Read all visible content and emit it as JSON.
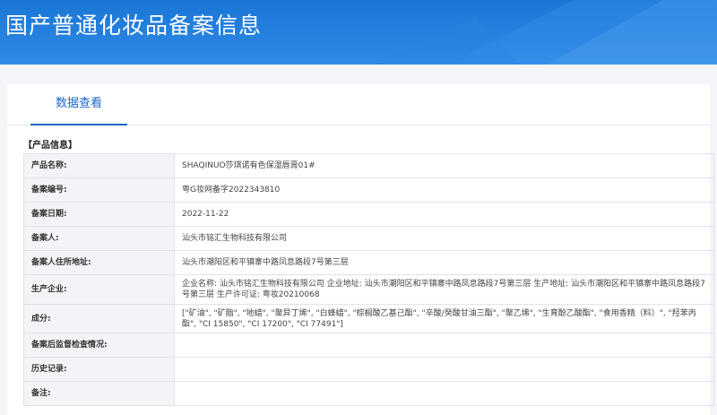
{
  "header": {
    "title": "国产普通化妆品备案信息"
  },
  "tabs": [
    {
      "label": "数据查看"
    }
  ],
  "section": {
    "title": "【产品信息】"
  },
  "rows": [
    {
      "label": "产品名称:",
      "value": "SHAQINUO莎琪诺有色保湿唇膏01#"
    },
    {
      "label": "备案编号:",
      "value": "粤G妆网备字2022343810"
    },
    {
      "label": "备案日期:",
      "value": "2022-11-22"
    },
    {
      "label": "备案人:",
      "value": "汕头市铭汇生物科技有限公司"
    },
    {
      "label": "备案人住所地址:",
      "value": "汕头市潮阳区和平镇寨中路凤息路段7号第三层"
    },
    {
      "label": "生产企业:",
      "value": "企业名称: 汕头市铭汇生物科技有限公司 企业地址: 汕头市潮阳区和平镇寨中路凤息路段7号第三层 生产地址: 汕头市潮阳区和平镇寨中路凤息路段7号第三层 生产许可证: 粤妆20210068"
    },
    {
      "label": "成分:",
      "value": "[\"矿油\", \"矿脂\", \"地蜡\", \"聚异丁烯\", \"白蜂蜡\", \"棕榈酸乙基己酯\", \"辛酸/癸酸甘油三酯\", \"聚乙烯\", \"生育酚乙酸酯\", \"食用香精（料）\", \"羟苯丙酯\", \"CI 15850\", \"CI 17200\", \"CI 77491\"]"
    },
    {
      "label": "备案后监督检查情况:",
      "value": ""
    },
    {
      "label": "历史记录:",
      "value": ""
    },
    {
      "label": "备注:",
      "value": ""
    }
  ]
}
